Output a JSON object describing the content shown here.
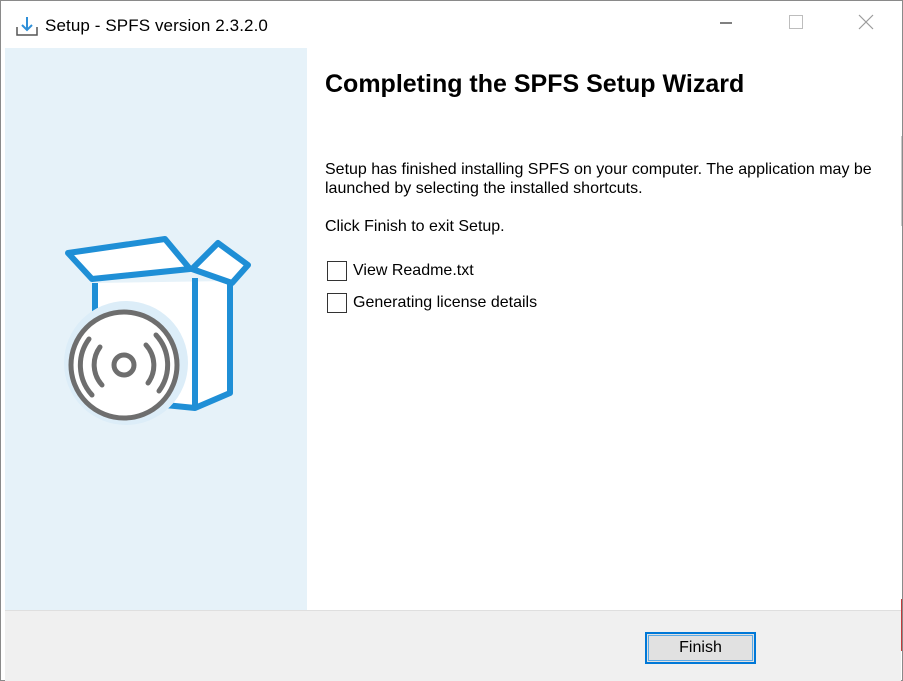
{
  "window": {
    "title": "Setup - SPFS version 2.3.2.0"
  },
  "icons": {
    "app": "installer-download-icon",
    "minimize": "minimize-icon",
    "maximize": "maximize-icon",
    "close": "close-icon",
    "side_art": "software-box-disc-icon"
  },
  "content": {
    "heading": "Completing the SPFS Setup Wizard",
    "paragraph_1": "Setup has finished installing SPFS on your computer. The application may be launched by selecting the installed shortcuts.",
    "paragraph_2": "Click Finish to exit Setup.",
    "options": [
      {
        "label": "View Readme.txt",
        "checked": false
      },
      {
        "label": "Generating license details",
        "checked": false
      }
    ]
  },
  "footer": {
    "finish_label": "Finish"
  },
  "colors": {
    "side_panel": "#e6f2f9",
    "accent": "#0078d7",
    "box_blue": "#1f8fd6",
    "disc_gray": "#6e6e6e",
    "footer": "#f0f0f0"
  }
}
